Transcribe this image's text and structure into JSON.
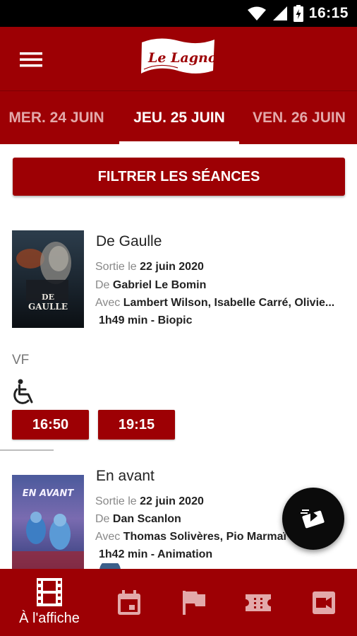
{
  "status_bar": {
    "time": "16:15"
  },
  "app": {
    "logo_text": "Le Lagnof"
  },
  "date_tabs": [
    {
      "label": "MER. 24 JUIN",
      "active": false
    },
    {
      "label": "JEU. 25 JUIN",
      "active": true
    },
    {
      "label": "VEN. 26 JUIN",
      "active": false
    }
  ],
  "filter_button": {
    "label": "FILTRER LES SÉANCES"
  },
  "movies": [
    {
      "title": "De Gaulle",
      "release_prefix": "Sortie le",
      "release_date": "22 juin 2020",
      "director_prefix": "De",
      "director": "Gabriel Le Bomin",
      "cast_prefix": "Avec",
      "cast": "Lambert Wilson, Isabelle Carré, Olivie...",
      "duration_genre": "1h49 min - Biopic",
      "poster_text": "DE GAULLE",
      "version": "VF",
      "showtimes": [
        "16:50",
        "19:15"
      ]
    },
    {
      "title": "En avant",
      "release_prefix": "Sortie le",
      "release_date": "22 juin 2020",
      "director_prefix": "De",
      "director": "Dan Scanlon",
      "cast_prefix": "Avec",
      "cast": "Thomas Solivères, Pio Marmaï",
      "duration_genre": "1h42 min - Animation",
      "poster_text": "EN AVANT"
    }
  ],
  "bottom_nav": [
    {
      "label": "À l'affiche",
      "icon": "film-icon",
      "active": true
    },
    {
      "label": "",
      "icon": "calendar-icon",
      "active": false
    },
    {
      "label": "",
      "icon": "flag-icon",
      "active": false
    },
    {
      "label": "",
      "icon": "ticket-icon",
      "active": false
    },
    {
      "label": "",
      "icon": "video-camera-icon",
      "active": false
    }
  ],
  "colors": {
    "primary": "#9d0004",
    "inactive_tab": "#e3a9aa",
    "fab": "#0b0b0b"
  }
}
